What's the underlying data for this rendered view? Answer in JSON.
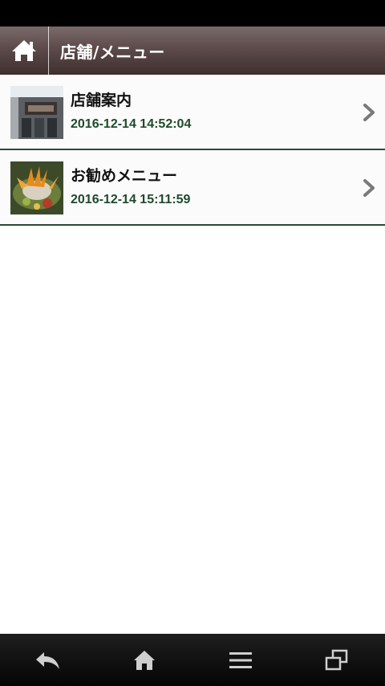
{
  "header": {
    "title": "店舗/メニュー",
    "home_icon": "home-icon"
  },
  "items": [
    {
      "title": "店舗案内",
      "date": "2016-12-14 14:52:04",
      "thumbnail": "storefront-photo"
    },
    {
      "title": "お勧めメニュー",
      "date": "2016-12-14 15:11:59",
      "thumbnail": "dish-photo"
    }
  ],
  "bottom_nav": [
    {
      "icon": "back-icon"
    },
    {
      "icon": "home-icon"
    },
    {
      "icon": "menu-icon"
    },
    {
      "icon": "windows-icon"
    }
  ],
  "colors": {
    "header_top": "#7b6a6a",
    "header_bottom": "#3f2f2f",
    "date_text": "#1f4a2c",
    "divider": "#2d4a35"
  }
}
